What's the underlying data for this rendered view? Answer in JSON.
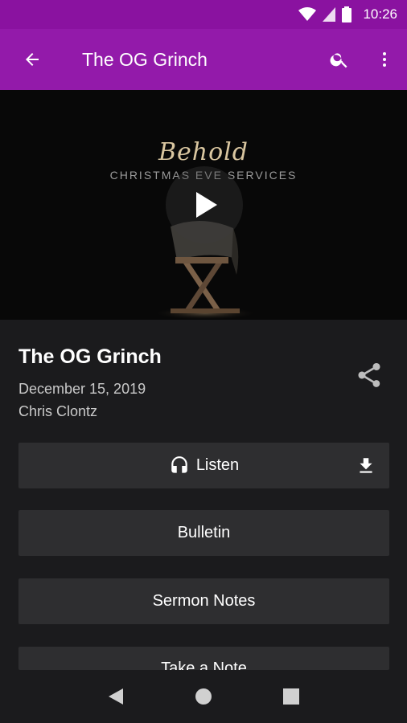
{
  "status_bar": {
    "time": "10:26"
  },
  "app_bar": {
    "title": "The OG Grinch",
    "icons": [
      "arrow-back-icon",
      "search-icon",
      "more-vert-icon"
    ]
  },
  "video": {
    "overlay_title": "Behold",
    "overlay_subtitle": "CHRISTMAS EVE SERVICES"
  },
  "sermon": {
    "title": "The OG Grinch",
    "date": "December 15, 2019",
    "speaker": "Chris Clontz"
  },
  "actions": {
    "listen": "Listen",
    "bulletin": "Bulletin",
    "sermon_notes": "Sermon Notes",
    "take_note": "Take a Note"
  },
  "colors": {
    "accent": "#931aaa",
    "status_bar": "#8a12a0",
    "background": "#1b1b1d",
    "button": "#2e2e30"
  }
}
